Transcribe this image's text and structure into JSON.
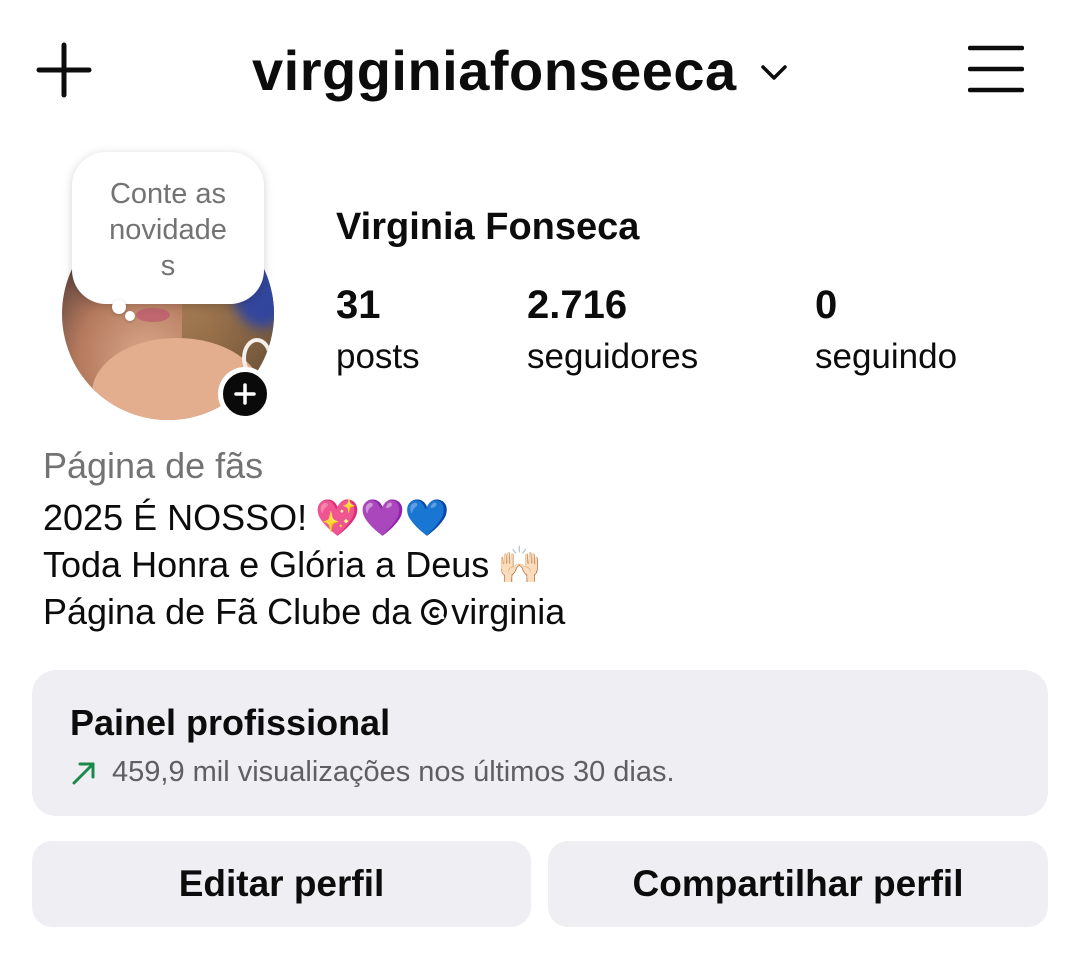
{
  "header": {
    "username": "virgginiafonseeca",
    "icons": {
      "create": "plus-icon",
      "account_switch": "chevron-down-icon",
      "menu": "hamburger-menu-icon"
    }
  },
  "note": {
    "lines": [
      "Conte as",
      "novidade",
      "s"
    ]
  },
  "profile": {
    "display_name": "Virginia Fonseca",
    "stats": {
      "posts": {
        "count": "31",
        "label": "posts"
      },
      "followers": {
        "count": "2.716",
        "label": "seguidores"
      },
      "following": {
        "count": "0",
        "label": "seguindo"
      }
    }
  },
  "bio": {
    "category": "Página de fãs",
    "line1": "2025 É NOSSO!",
    "line1_emoji": "💖💜💙",
    "line2": "Toda Honra e Glória a Deus",
    "line2_emoji": "🙌🏻",
    "line3_prefix": "Página de Fã Clube da",
    "line3_handle": "virginia",
    "threads_icon": "threads-icon"
  },
  "dashboard": {
    "title": "Painel profissional",
    "subtitle": "459,9 mil visualizações nos últimos 30 dias.",
    "trend_icon": "trend-up-arrow-icon",
    "trend_color": "#1a8a4a"
  },
  "buttons": {
    "edit": "Editar perfil",
    "share": "Compartilhar perfil"
  }
}
